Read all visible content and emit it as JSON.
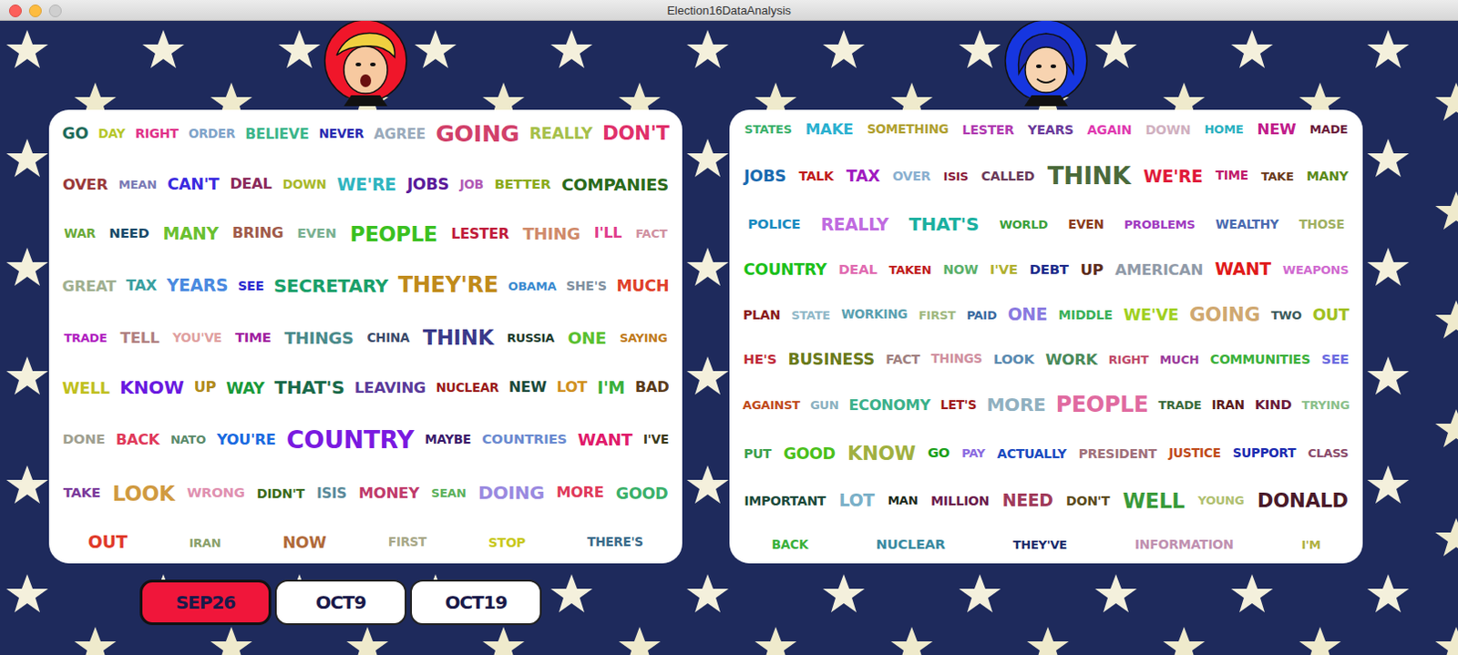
{
  "window": {
    "title": "Election16DataAnalysis"
  },
  "candidates": [
    {
      "color": "#f0162a",
      "words": [
        {
          "text": "GO",
          "color": "#1f6b5a",
          "level": 0.25
        },
        {
          "text": "DAY",
          "color": "#b5c62a",
          "level": 0.1
        },
        {
          "text": "RIGHT",
          "color": "#e0338a",
          "level": 0.12
        },
        {
          "text": "ORDER",
          "color": "#7fa3c9",
          "level": 0.1
        },
        {
          "text": "BELIEVE",
          "color": "#3cb58a",
          "level": 0.18
        },
        {
          "text": "NEVER",
          "color": "#2a2ab0",
          "level": 0.1
        },
        {
          "text": "AGREE",
          "color": "#9aaabb",
          "level": 0.18
        },
        {
          "text": "GOING",
          "color": "#d1406a",
          "level": 0.55
        },
        {
          "text": "REALLY",
          "color": "#a6c04a",
          "level": 0.25
        },
        {
          "text": "DON'T",
          "color": "#e0306a",
          "level": 0.4
        },
        {
          "text": "OVER",
          "color": "#9a3a3a",
          "level": 0.22
        },
        {
          "text": "MEAN",
          "color": "#7a7ab5",
          "level": 0.08
        },
        {
          "text": "CAN'T",
          "color": "#3a2ae0",
          "level": 0.25
        },
        {
          "text": "DEAL",
          "color": "#8a2a5a",
          "level": 0.2
        },
        {
          "text": "DOWN",
          "color": "#a8b82a",
          "level": 0.1
        },
        {
          "text": "WE'RE",
          "color": "#30b5c0",
          "level": 0.3
        },
        {
          "text": "JOBS",
          "color": "#5a1a9a",
          "level": 0.25
        },
        {
          "text": "JOB",
          "color": "#b05ab5",
          "level": 0.1
        },
        {
          "text": "BETTER",
          "color": "#8aaa1a",
          "level": 0.15
        },
        {
          "text": "COMPANIES",
          "color": "#2a6a1a",
          "level": 0.28
        },
        {
          "text": "WAR",
          "color": "#6aaa3a",
          "level": 0.1
        },
        {
          "text": "NEED",
          "color": "#1a4a6a",
          "level": 0.15
        },
        {
          "text": "MANY",
          "color": "#6ac030",
          "level": 0.3
        },
        {
          "text": "BRING",
          "color": "#a05a4a",
          "level": 0.2
        },
        {
          "text": "EVEN",
          "color": "#7ab090",
          "level": 0.15
        },
        {
          "text": "PEOPLE",
          "color": "#3ac020",
          "level": 0.45
        },
        {
          "text": "LESTER",
          "color": "#c01a3a",
          "level": 0.18
        },
        {
          "text": "THING",
          "color": "#d08a6a",
          "level": 0.28
        },
        {
          "text": "I'LL",
          "color": "#e03a8a",
          "level": 0.2
        },
        {
          "text": "FACT",
          "color": "#d090a0",
          "level": 0.08
        },
        {
          "text": "GREAT",
          "color": "#a0b090",
          "level": 0.22
        },
        {
          "text": "TAX",
          "color": "#3aa0a0",
          "level": 0.2
        },
        {
          "text": "YEARS",
          "color": "#4a8ae0",
          "level": 0.3
        },
        {
          "text": "SEE",
          "color": "#2a2ad0",
          "level": 0.12
        },
        {
          "text": "SECRETARY",
          "color": "#1aa06a",
          "level": 0.35
        },
        {
          "text": "THEY'RE",
          "color": "#c08a1a",
          "level": 0.5
        },
        {
          "text": "OBAMA",
          "color": "#3a8ad0",
          "level": 0.08
        },
        {
          "text": "SHE'S",
          "color": "#8090a0",
          "level": 0.12
        },
        {
          "text": "MUCH",
          "color": "#e0402a",
          "level": 0.25
        },
        {
          "text": "TRADE",
          "color": "#b020c0",
          "level": 0.08
        },
        {
          "text": "TELL",
          "color": "#b08080",
          "level": 0.22
        },
        {
          "text": "YOU'VE",
          "color": "#e0a0a0",
          "level": 0.1
        },
        {
          "text": "TIME",
          "color": "#a020a0",
          "level": 0.15
        },
        {
          "text": "THINGS",
          "color": "#4a8a8a",
          "level": 0.28
        },
        {
          "text": "CHINA",
          "color": "#3a4a6a",
          "level": 0.1
        },
        {
          "text": "THINK",
          "color": "#3a3a8a",
          "level": 0.45
        },
        {
          "text": "RUSSIA",
          "color": "#1a3a2a",
          "level": 0.08
        },
        {
          "text": "ONE",
          "color": "#5ac030",
          "level": 0.28
        },
        {
          "text": "SAYING",
          "color": "#c07a1a",
          "level": 0.08
        },
        {
          "text": "WELL",
          "color": "#c0c020",
          "level": 0.25
        },
        {
          "text": "KNOW",
          "color": "#6a1ae0",
          "level": 0.35
        },
        {
          "text": "UP",
          "color": "#b08a1a",
          "level": 0.2
        },
        {
          "text": "WAY",
          "color": "#1a9a3a",
          "level": 0.25
        },
        {
          "text": "THAT'S",
          "color": "#1a6a4a",
          "level": 0.35
        },
        {
          "text": "LEAVING",
          "color": "#5a3a9a",
          "level": 0.22
        },
        {
          "text": "NUCLEAR",
          "color": "#9a1a1a",
          "level": 0.1
        },
        {
          "text": "NEW",
          "color": "#1a4a3a",
          "level": 0.2
        },
        {
          "text": "LOT",
          "color": "#d09020",
          "level": 0.2
        },
        {
          "text": "I'M",
          "color": "#3ab03a",
          "level": 0.3
        },
        {
          "text": "BAD",
          "color": "#5a3a1a",
          "level": 0.2
        },
        {
          "text": "DONE",
          "color": "#a0a090",
          "level": 0.15
        },
        {
          "text": "BACK",
          "color": "#e03a5a",
          "level": 0.2
        },
        {
          "text": "NATO",
          "color": "#5a8a6a",
          "level": 0.08
        },
        {
          "text": "YOU'RE",
          "color": "#1a6ae0",
          "level": 0.2
        },
        {
          "text": "COUNTRY",
          "color": "#7a1ae0",
          "level": 0.6
        },
        {
          "text": "MAYBE",
          "color": "#3a1a6a",
          "level": 0.1
        },
        {
          "text": "COUNTRIES",
          "color": "#6a8ad0",
          "level": 0.15
        },
        {
          "text": "WANT",
          "color": "#e01a6a",
          "level": 0.28
        },
        {
          "text": "I'VE",
          "color": "#3a3a1a",
          "level": 0.1
        },
        {
          "text": "TAKE",
          "color": "#7a3a9a",
          "level": 0.15
        },
        {
          "text": "LOOK",
          "color": "#d09a40",
          "level": 0.45
        },
        {
          "text": "WRONG",
          "color": "#e090b0",
          "level": 0.15
        },
        {
          "text": "DIDN'T",
          "color": "#3a6a1a",
          "level": 0.12
        },
        {
          "text": "ISIS",
          "color": "#5a8a9a",
          "level": 0.18
        },
        {
          "text": "MONEY",
          "color": "#c03a6a",
          "level": 0.22
        },
        {
          "text": "SEAN",
          "color": "#5ab05a",
          "level": 0.08
        },
        {
          "text": "DOING",
          "color": "#9a8ae0",
          "level": 0.35
        },
        {
          "text": "MORE",
          "color": "#e03a5a",
          "level": 0.2
        },
        {
          "text": "GOOD",
          "color": "#3ab06a",
          "level": 0.25
        },
        {
          "text": "OUT",
          "color": "#e03a2a",
          "level": 0.3
        },
        {
          "text": "IRAN",
          "color": "#8aa06a",
          "level": 0.08
        },
        {
          "text": "NOW",
          "color": "#b06a3a",
          "level": 0.25
        },
        {
          "text": "FIRST",
          "color": "#a8a888",
          "level": 0.1
        },
        {
          "text": "STOP",
          "color": "#c8c81a",
          "level": 0.12
        },
        {
          "text": "THERE'S",
          "color": "#3a6a8a",
          "level": 0.1
        }
      ]
    },
    {
      "color": "#1636e0",
      "words": [
        {
          "text": "STATES",
          "color": "#3ab06a",
          "level": 0.08
        },
        {
          "text": "MAKE",
          "color": "#2ab0d0",
          "level": 0.22
        },
        {
          "text": "SOMETHING",
          "color": "#b0a030",
          "level": 0.1
        },
        {
          "text": "LESTER",
          "color": "#b03ab0",
          "level": 0.12
        },
        {
          "text": "YEARS",
          "color": "#6a3a9a",
          "level": 0.12
        },
        {
          "text": "AGAIN",
          "color": "#e03ab0",
          "level": 0.12
        },
        {
          "text": "DOWN",
          "color": "#d0b0c0",
          "level": 0.12
        },
        {
          "text": "HOME",
          "color": "#2ab0c0",
          "level": 0.08
        },
        {
          "text": "NEW",
          "color": "#c01a8a",
          "level": 0.22
        },
        {
          "text": "MADE",
          "color": "#6a1a3a",
          "level": 0.08
        },
        {
          "text": "JOBS",
          "color": "#1a6ab0",
          "level": 0.25
        },
        {
          "text": "TALK",
          "color": "#c01a1a",
          "level": 0.12
        },
        {
          "text": "TAX",
          "color": "#a01ac0",
          "level": 0.25
        },
        {
          "text": "OVER",
          "color": "#8ab0d0",
          "level": 0.12
        },
        {
          "text": "ISIS",
          "color": "#8a1a3a",
          "level": 0.08
        },
        {
          "text": "CALLED",
          "color": "#6a3a5a",
          "level": 0.12
        },
        {
          "text": "THINK",
          "color": "#4a6a3a",
          "level": 0.6
        },
        {
          "text": "WE'RE",
          "color": "#e01a3a",
          "level": 0.3
        },
        {
          "text": "TIME",
          "color": "#c01a6a",
          "level": 0.1
        },
        {
          "text": "TAKE",
          "color": "#6a3a1a",
          "level": 0.08
        },
        {
          "text": "MANY",
          "color": "#5a8a1a",
          "level": 0.12
        },
        {
          "text": "POLICE",
          "color": "#1a8ac0",
          "level": 0.15
        },
        {
          "text": "REALLY",
          "color": "#c06ae0",
          "level": 0.3
        },
        {
          "text": "THAT'S",
          "color": "#1ab0a0",
          "level": 0.35
        },
        {
          "text": "WORLD",
          "color": "#3aa03a",
          "level": 0.08
        },
        {
          "text": "EVEN",
          "color": "#8a3a1a",
          "level": 0.1
        },
        {
          "text": "PROBLEMS",
          "color": "#a03ac0",
          "level": 0.08
        },
        {
          "text": "WEALTHY",
          "color": "#4a6ab0",
          "level": 0.1
        },
        {
          "text": "THOSE",
          "color": "#a0b060",
          "level": 0.1
        },
        {
          "text": "COUNTRY",
          "color": "#1ac01a",
          "level": 0.25
        },
        {
          "text": "DEAL",
          "color": "#e06ab0",
          "level": 0.15
        },
        {
          "text": "TAKEN",
          "color": "#c01a1a",
          "level": 0.08
        },
        {
          "text": "NOW",
          "color": "#5ab06a",
          "level": 0.12
        },
        {
          "text": "I'VE",
          "color": "#b0b030",
          "level": 0.15
        },
        {
          "text": "DEBT",
          "color": "#1a2a8a",
          "level": 0.15
        },
        {
          "text": "UP",
          "color": "#5a2a1a",
          "level": 0.22
        },
        {
          "text": "AMERICAN",
          "color": "#909aa8",
          "level": 0.22
        },
        {
          "text": "WANT",
          "color": "#e01a1a",
          "level": 0.3
        },
        {
          "text": "WEAPONS",
          "color": "#d06ad0",
          "level": 0.08
        },
        {
          "text": "PLAN",
          "color": "#8a1a1a",
          "level": 0.12
        },
        {
          "text": "STATE",
          "color": "#90b8c8",
          "level": 0.08
        },
        {
          "text": "WORKING",
          "color": "#5aa0b0",
          "level": 0.1
        },
        {
          "text": "FIRST",
          "color": "#a0b880",
          "level": 0.08
        },
        {
          "text": "PAID",
          "color": "#3a6aa0",
          "level": 0.08
        },
        {
          "text": "ONE",
          "color": "#8a7ae0",
          "level": 0.3
        },
        {
          "text": "MIDDLE",
          "color": "#3ab05a",
          "level": 0.12
        },
        {
          "text": "WE'VE",
          "color": "#a0d020",
          "level": 0.25
        },
        {
          "text": "GOING",
          "color": "#d0a870",
          "level": 0.4
        },
        {
          "text": "TWO",
          "color": "#3a5a5a",
          "level": 0.08
        },
        {
          "text": "OUT",
          "color": "#a0c020",
          "level": 0.25
        },
        {
          "text": "HE'S",
          "color": "#c02a3a",
          "level": 0.15
        },
        {
          "text": "BUSINESS",
          "color": "#6a7a1a",
          "level": 0.25
        },
        {
          "text": "FACT",
          "color": "#a08080",
          "level": 0.12
        },
        {
          "text": "THINGS",
          "color": "#d090a0",
          "level": 0.1
        },
        {
          "text": "LOOK",
          "color": "#5a8ab0",
          "level": 0.15
        },
        {
          "text": "WORK",
          "color": "#4a8a5a",
          "level": 0.22
        },
        {
          "text": "RIGHT",
          "color": "#c04a6a",
          "level": 0.08
        },
        {
          "text": "MUCH",
          "color": "#9a3a9a",
          "level": 0.08
        },
        {
          "text": "COMMUNITIES",
          "color": "#3ab03a",
          "level": 0.12
        },
        {
          "text": "SEE",
          "color": "#6a6ae0",
          "level": 0.15
        },
        {
          "text": "AGAINST",
          "color": "#c04a1a",
          "level": 0.08
        },
        {
          "text": "GUN",
          "color": "#8ab0c0",
          "level": 0.08
        },
        {
          "text": "ECONOMY",
          "color": "#3ab08a",
          "level": 0.2
        },
        {
          "text": "LET'S",
          "color": "#a01a1a",
          "level": 0.1
        },
        {
          "text": "MORE",
          "color": "#90b0c0",
          "level": 0.35
        },
        {
          "text": "PEOPLE",
          "color": "#e06aa0",
          "level": 0.5
        },
        {
          "text": "TRADE",
          "color": "#3a6a3a",
          "level": 0.08
        },
        {
          "text": "IRAN",
          "color": "#5a1a1a",
          "level": 0.1
        },
        {
          "text": "KIND",
          "color": "#6a1a3a",
          "level": 0.15
        },
        {
          "text": "TRYING",
          "color": "#8ac08a",
          "level": 0.08
        },
        {
          "text": "PUT",
          "color": "#3aa04a",
          "level": 0.12
        },
        {
          "text": "GOOD",
          "color": "#4ac01a",
          "level": 0.25
        },
        {
          "text": "KNOW",
          "color": "#a0b040",
          "level": 0.4
        },
        {
          "text": "GO",
          "color": "#1aa01a",
          "level": 0.15
        },
        {
          "text": "PAY",
          "color": "#8a6ae0",
          "level": 0.08
        },
        {
          "text": "ACTUALLY",
          "color": "#1a4ac0",
          "level": 0.12
        },
        {
          "text": "PRESIDENT",
          "color": "#a0707a",
          "level": 0.12
        },
        {
          "text": "JUSTICE",
          "color": "#c04a1a",
          "level": 0.1
        },
        {
          "text": "SUPPORT",
          "color": "#1a2ab0",
          "level": 0.1
        },
        {
          "text": "CLASS",
          "color": "#8a4a6a",
          "level": 0.08
        },
        {
          "text": "IMPORTANT",
          "color": "#1a4a3a",
          "level": 0.12
        },
        {
          "text": "LOT",
          "color": "#7ab0c8",
          "level": 0.3
        },
        {
          "text": "MAN",
          "color": "#1a2a1a",
          "level": 0.08
        },
        {
          "text": "MILLION",
          "color": "#6a1a4a",
          "level": 0.12
        },
        {
          "text": "NEED",
          "color": "#a03a5a",
          "level": 0.3
        },
        {
          "text": "DON'T",
          "color": "#5a4a1a",
          "level": 0.12
        },
        {
          "text": "WELL",
          "color": "#3a9a3a",
          "level": 0.45
        },
        {
          "text": "YOUNG",
          "color": "#b0c070",
          "level": 0.08
        },
        {
          "text": "DONALD",
          "color": "#4a1a2a",
          "level": 0.4
        },
        {
          "text": "BACK",
          "color": "#3ab03a",
          "level": 0.1
        },
        {
          "text": "NUCLEAR",
          "color": "#3a8aa0",
          "level": 0.15
        },
        {
          "text": "THEY'VE",
          "color": "#1a2a6a",
          "level": 0.08
        },
        {
          "text": "INFORMATION",
          "color": "#c090b0",
          "level": 0.12
        },
        {
          "text": "I'M",
          "color": "#b0b040",
          "level": 0.08
        }
      ]
    }
  ],
  "date_tabs": [
    {
      "label": "SEP26",
      "selected": true
    },
    {
      "label": "OCT9",
      "selected": false
    },
    {
      "label": "OCT19",
      "selected": false
    }
  ]
}
